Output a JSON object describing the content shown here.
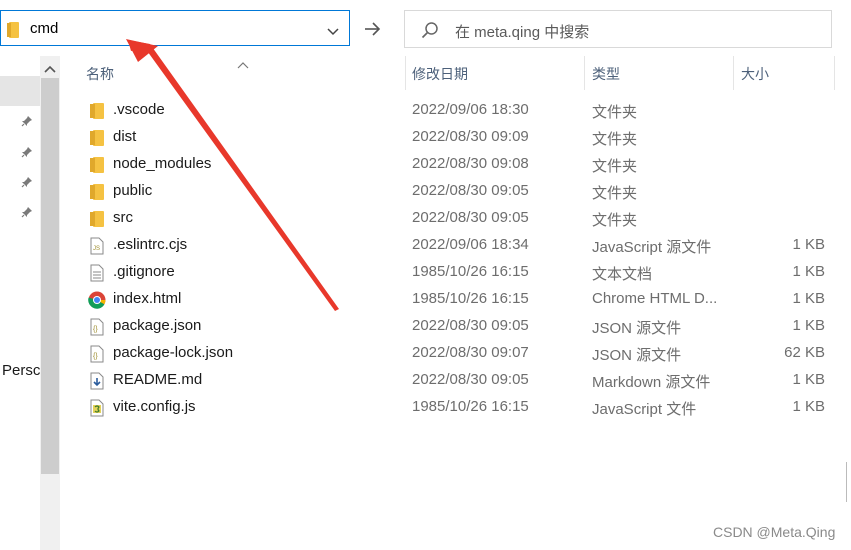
{
  "address_bar": {
    "path": "cmd"
  },
  "search": {
    "placeholder": "在 meta.qing 中搜索"
  },
  "nav": {
    "truncated_label": "Persc"
  },
  "columns": {
    "name": "名称",
    "date": "修改日期",
    "type": "类型",
    "size": "大小"
  },
  "files": [
    {
      "name": ".vscode",
      "date": "2022/09/06 18:30",
      "type": "文件夹",
      "size": "",
      "icon": "folder-icon"
    },
    {
      "name": "dist",
      "date": "2022/08/30 09:09",
      "type": "文件夹",
      "size": "",
      "icon": "folder-icon"
    },
    {
      "name": "node_modules",
      "date": "2022/08/30 09:08",
      "type": "文件夹",
      "size": "",
      "icon": "folder-icon"
    },
    {
      "name": "public",
      "date": "2022/08/30 09:05",
      "type": "文件夹",
      "size": "",
      "icon": "folder-icon"
    },
    {
      "name": "src",
      "date": "2022/08/30 09:05",
      "type": "文件夹",
      "size": "",
      "icon": "folder-icon"
    },
    {
      "name": ".eslintrc.cjs",
      "date": "2022/09/06 18:34",
      "type": "JavaScript 源文件",
      "size": "1 KB",
      "icon": "js-file-icon"
    },
    {
      "name": ".gitignore",
      "date": "1985/10/26 16:15",
      "type": "文本文档",
      "size": "1 KB",
      "icon": "text-file-icon"
    },
    {
      "name": "index.html",
      "date": "1985/10/26 16:15",
      "type": "Chrome HTML D...",
      "size": "1 KB",
      "icon": "chrome-icon"
    },
    {
      "name": "package.json",
      "date": "2022/08/30 09:05",
      "type": "JSON 源文件",
      "size": "1 KB",
      "icon": "json-file-icon"
    },
    {
      "name": "package-lock.json",
      "date": "2022/08/30 09:07",
      "type": "JSON 源文件",
      "size": "62 KB",
      "icon": "json-file-icon"
    },
    {
      "name": "README.md",
      "date": "2022/08/30 09:05",
      "type": "Markdown 源文件",
      "size": "1 KB",
      "icon": "markdown-file-icon"
    },
    {
      "name": "vite.config.js",
      "date": "1985/10/26 16:15",
      "type": "JavaScript 文件",
      "size": "1 KB",
      "icon": "js-script-icon"
    }
  ],
  "watermark": "CSDN @Meta.Qing",
  "colors": {
    "accent": "#0078d7",
    "folder": "#f5c242",
    "annotation_arrow": "#e8382b"
  }
}
